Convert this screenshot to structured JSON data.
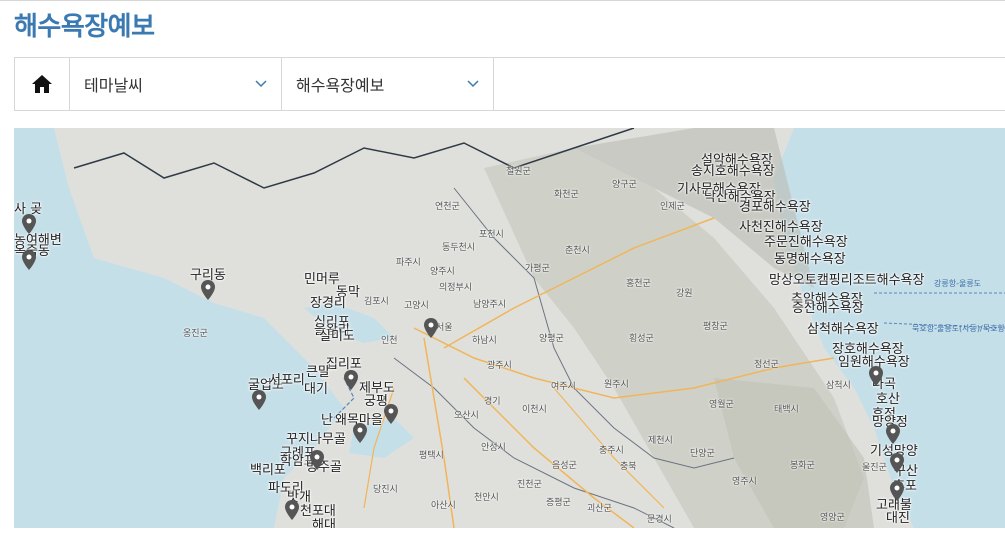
{
  "page": {
    "title": "해수욕장예보"
  },
  "nav": {
    "home_icon": "home-icon",
    "category_select": "테마날씨",
    "theme_select": "해수욕장예보"
  },
  "map": {
    "colors": {
      "land": "#dfe0dc",
      "sea": "#c5dfe9",
      "terrain": "#c4c6bd",
      "highway": "#f0b559",
      "border": "#2f3a46",
      "marker": "#555555"
    },
    "sea_routes": [
      "강릉항-울릉도",
      "묵호항-울릉도(사동)/묵호항-울릉도"
    ],
    "region_labels": [
      "철원군",
      "화천군",
      "양구군",
      "인제군",
      "연천군",
      "포천시",
      "춘천시",
      "동두천시",
      "가평군",
      "파주시",
      "양주시",
      "의정부시",
      "남양주시",
      "고양시",
      "김포시",
      "인천",
      "서울",
      "하남시",
      "홍천군",
      "강원",
      "횡성군",
      "양평군",
      "광주시",
      "평창군",
      "정선군",
      "원주시",
      "여주시",
      "이천시",
      "경기",
      "삼척시",
      "영월군",
      "태백시",
      "제천시",
      "단양군",
      "충주시",
      "충북",
      "음성군",
      "진천군",
      "안성시",
      "평택시",
      "오산시",
      "당진시",
      "아산시",
      "천안시",
      "괴산군",
      "증평군",
      "문경시",
      "봉화군",
      "영주시",
      "울진군",
      "영양군",
      "옹진군"
    ],
    "beaches": [
      "사 곶",
      "농여해변",
      "옥죽동",
      "구리동",
      "민머루",
      "동막",
      "장경리",
      "십리포",
      "을왕리",
      "실미도",
      "집리포",
      "큰말",
      "굴업도",
      "서포리",
      "대기",
      "제부도",
      "궁평",
      "난",
      "왜목마을",
      "꾸지나무골",
      "구례포",
      "학암포",
      "백리포",
      "파도리",
      "밧개",
      "천포대",
      "해대",
      "방주골",
      "설악해수욕장",
      "송지호해수욕장",
      "기사문해수욕장",
      "낙산해수욕장",
      "경포해수욕장",
      "사천진해수욕장",
      "주문진해수욕장",
      "동명해수욕장",
      "망상오토캠핑리조트해수욕장",
      "추암해수욕장",
      "증산해수욕장",
      "삼척해수욕장",
      "장호해수욕장",
      "임원해수욕장",
      "나곡",
      "호산",
      "후정",
      "망양정",
      "기성망양",
      "구산",
      "후포",
      "고래불",
      "대진"
    ]
  }
}
